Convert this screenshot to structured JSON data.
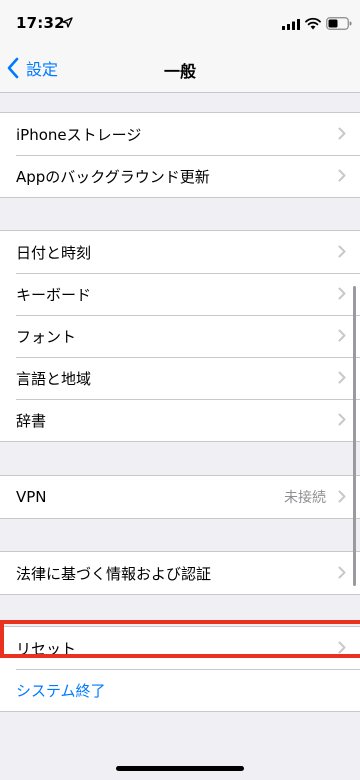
{
  "status_bar": {
    "time": "17:32"
  },
  "nav": {
    "back_label": "設定",
    "title": "一般"
  },
  "groups": {
    "storage": [
      {
        "label": "iPhoneストレージ"
      },
      {
        "label": "Appのバックグラウンド更新"
      }
    ],
    "regional": [
      {
        "label": "日付と時刻"
      },
      {
        "label": "キーボード"
      },
      {
        "label": "フォント"
      },
      {
        "label": "言語と地域"
      },
      {
        "label": "辞書"
      }
    ],
    "vpn": {
      "label": "VPN",
      "value": "未接続"
    },
    "legal": {
      "label": "法律に基づく情報および認証"
    },
    "reset": {
      "label": "リセット"
    },
    "shutdown": {
      "label": "システム終了"
    }
  },
  "colors": {
    "accent": "#007aff",
    "highlight": "#e8311f",
    "background": "#efeff4"
  }
}
